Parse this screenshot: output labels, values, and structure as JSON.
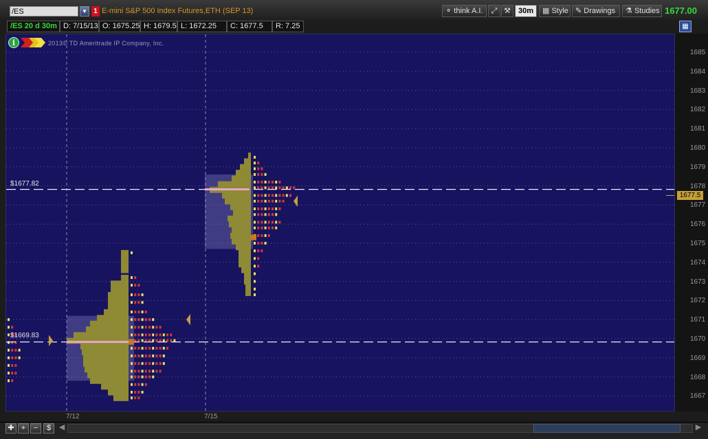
{
  "toolbar": {
    "symbol": "/ES",
    "link_badge": "1",
    "description": "E-mini S&P 500 Index Futures,ETH (SEP 13)",
    "think_ai": "think A.I.",
    "timeframe": "30m",
    "style": "Style",
    "drawings": "Drawings",
    "studies": "Studies",
    "last_price": "1677.00"
  },
  "infobar": {
    "period": "/ES 20 d 30m",
    "date": "D: 7/15/13",
    "open": "O: 1675.25",
    "high": "H: 1679.5",
    "low": "L: 1672.25",
    "close": "C: 1677.5",
    "range": "R: 7.25"
  },
  "chart": {
    "copyright": "2013© TD Ameritrade IP Company, Inc.",
    "poc_labels": [
      "$1677.82",
      "$1669.83"
    ],
    "price_tag": "1677.5",
    "yticks": [
      "1685",
      "1684",
      "1683",
      "1682",
      "1681",
      "1680",
      "1679",
      "1678",
      "1677",
      "1676",
      "1675",
      "1674",
      "1673",
      "1672",
      "1671",
      "1670",
      "1669",
      "1668",
      "1667"
    ],
    "xticks": [
      "7/12",
      "7/15"
    ]
  },
  "colors": {
    "plot_bg": "#17135f",
    "profile_fill": "#8f8a35",
    "value_area": "#8a8ac8",
    "poc_line": "#e8a8c8",
    "last_price": "#38d838",
    "letters_red": "#d03a3a",
    "letters_yellow": "#e8e060"
  },
  "chart_data": {
    "type": "table",
    "title": "/ES 20 d 30m",
    "profiles": [
      {
        "date": "7/12",
        "poc_price": 1669.83,
        "low": 1666.75,
        "high": 1674.5
      },
      {
        "date": "7/15",
        "poc_price": 1677.82,
        "low": 1672.25,
        "high": 1679.5
      }
    ],
    "last": 1677.5
  }
}
